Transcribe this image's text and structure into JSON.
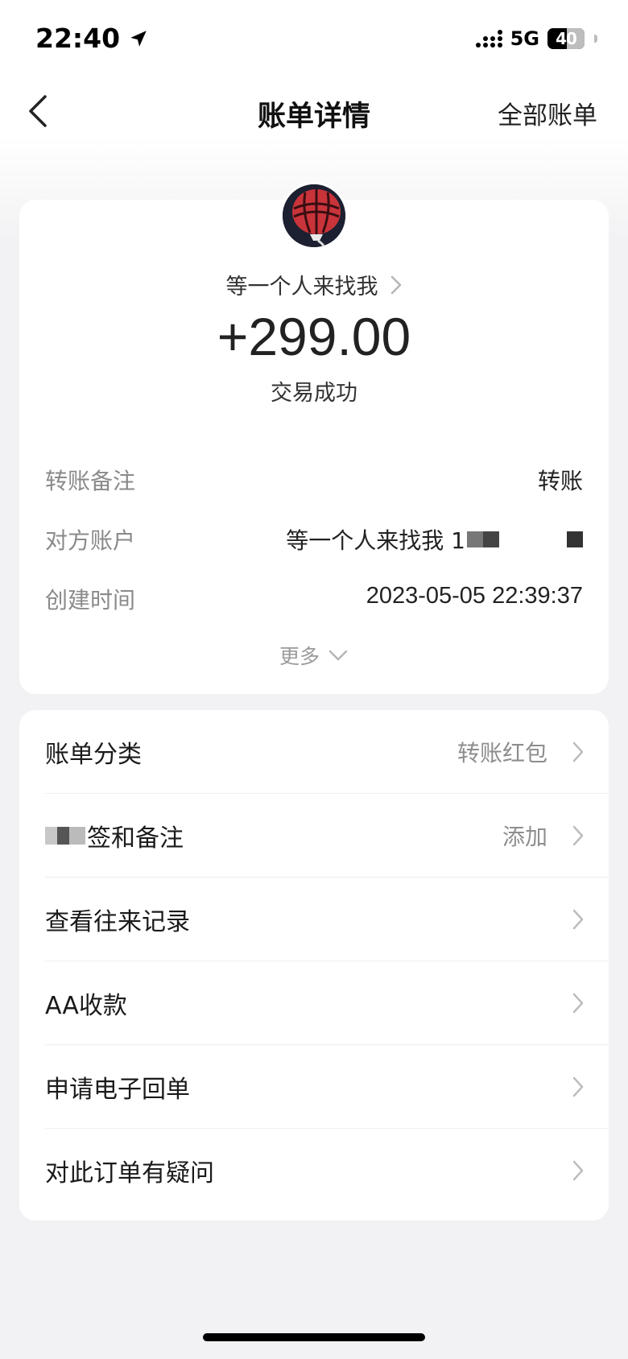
{
  "status_bar": {
    "time": "22:40",
    "network": "5G",
    "battery": "40"
  },
  "nav": {
    "title": "账单详情",
    "right_label": "全部账单"
  },
  "summary": {
    "payee_name": "等一个人来找我",
    "amount": "+299.00",
    "status": "交易成功"
  },
  "details": {
    "memo_label": "转账备注",
    "memo_value": "转账",
    "account_label": "对方账户",
    "account_value": "等一个人来找我 1",
    "time_label": "创建时间",
    "time_value": "2023-05-05 22:39:37",
    "more_label": "更多"
  },
  "menu": {
    "items": [
      {
        "label": "账单分类",
        "value": "转账红包"
      },
      {
        "label": "签和备注",
        "value": "添加"
      },
      {
        "label": "查看往来记录",
        "value": ""
      },
      {
        "label": "AA收款",
        "value": ""
      },
      {
        "label": "申请电子回单",
        "value": ""
      },
      {
        "label": "对此订单有疑问",
        "value": ""
      }
    ]
  },
  "icons": [
    "location-arrow-icon",
    "signal-icon",
    "battery-icon",
    "back-icon",
    "chevron-right-icon",
    "chevron-down-icon"
  ],
  "colors": {
    "background": "#f2f2f4",
    "card": "#ffffff",
    "muted_text": "#8a8a8a",
    "primary_text": "#1a1a1a"
  }
}
